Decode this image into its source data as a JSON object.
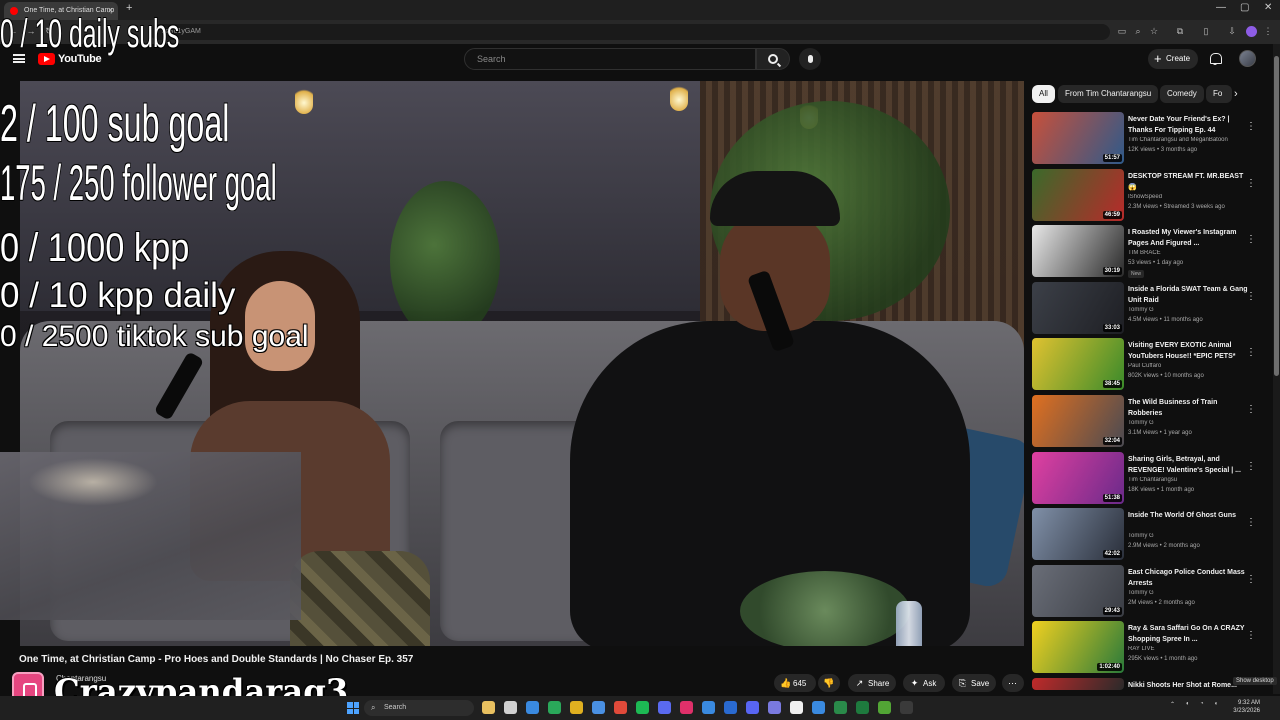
{
  "browser": {
    "tab_title": "One Time, at Christian Camp",
    "url_fragment": "YsGo1yGAM"
  },
  "header": {
    "logo_text": "YouTube",
    "search_placeholder": "Search",
    "create_label": "Create"
  },
  "overlay": {
    "daily_subs": "0 / 10 daily subs",
    "sub_goal": "2  / 100 sub goal",
    "follower_goal": "175 / 250 follower goal",
    "kpp": "0 / 1000 kpp",
    "kpp_daily": "0 / 10 kpp daily",
    "tiktok_goal": "0 / 2500 tiktok sub goal",
    "streamer_name": "Crazypandarag3"
  },
  "video": {
    "title": "One Time, at Christian Camp - Pro Hoes and Double Standards | No Chaser Ep. 357",
    "channel": "Chantarangsu",
    "like_count": "645",
    "share_label": "Share",
    "ask_label": "Ask",
    "save_label": "Save"
  },
  "chips": [
    {
      "label": "All",
      "active": true
    },
    {
      "label": "From Tim Chantarangsu",
      "active": false
    },
    {
      "label": "Comedy",
      "active": false
    },
    {
      "label": "Fo",
      "active": false
    }
  ],
  "recommendations": [
    {
      "title": "Never Date Your Friend's Ex? | Thanks For Tipping Ep. 44",
      "channel": "Tim Chantarangsu and MeganBatoon",
      "meta": "12K views • 3 months ago",
      "duration": "51:57",
      "badge": "",
      "colors": [
        "#c7503b",
        "#2f5a8a"
      ]
    },
    {
      "title": "DESKTOP STREAM FT. MR.BEAST 😱",
      "channel": "IShowSpeed",
      "meta": "2.3M views • Streamed 3 weeks ago",
      "duration": "46:59",
      "badge": "",
      "colors": [
        "#3a6a2a",
        "#b82a2a"
      ]
    },
    {
      "title": "I Roasted My Viewer's Instagram Pages And Figured ...",
      "channel": "TIM BRACE",
      "meta": "53 views • 1 day ago",
      "duration": "30:19",
      "badge": "New",
      "colors": [
        "#e8e8e8",
        "#2a2a2a"
      ]
    },
    {
      "title": "Inside a Florida SWAT Team & Gang Unit Raid",
      "channel": "Tommy G",
      "meta": "4.5M views • 11 months ago",
      "duration": "33:03",
      "badge": "",
      "colors": [
        "#3c4048",
        "#1e1f24"
      ]
    },
    {
      "title": "Visiting EVERY EXOTIC Animal YouTubers House!! *EPIC PETS*",
      "channel": "Paul Cuffaro",
      "meta": "802K views • 10 months ago",
      "duration": "38:45",
      "badge": "",
      "colors": [
        "#e0c230",
        "#3a8a2a"
      ]
    },
    {
      "title": "The Wild Business of Train Robberies",
      "channel": "Tommy G",
      "meta": "3.1M views • 1 year ago",
      "duration": "32:04",
      "badge": "",
      "colors": [
        "#e07020",
        "#4a4a52"
      ]
    },
    {
      "title": "Sharing Girls, Betrayal, and REVENGE! Valentine's Special | ...",
      "channel": "Tim Chantarangsu",
      "meta": "18K views • 1 month ago",
      "duration": "51:38",
      "badge": "",
      "colors": [
        "#e040a0",
        "#6a2a8a"
      ]
    },
    {
      "title": "Inside The World Of Ghost Guns",
      "channel": "Tommy G",
      "meta": "2.9M views • 2 months ago",
      "duration": "42:02",
      "badge": "",
      "colors": [
        "#8090a8",
        "#2a2f3a"
      ]
    },
    {
      "title": "East Chicago Police Conduct Mass Arrests",
      "channel": "Tommy G",
      "meta": "2M views • 2 months ago",
      "duration": "29:43",
      "badge": "",
      "colors": [
        "#6a6e78",
        "#3a3d44"
      ]
    },
    {
      "title": "Ray & Sara Saffari Go On A CRAZY Shopping Spree In ...",
      "channel": "RAY LIVE",
      "meta": "295K views • 1 month ago",
      "duration": "1:02:40",
      "badge": "",
      "colors": [
        "#f0d020",
        "#2a7a3a"
      ]
    },
    {
      "title": "Nikki Shoots Her Shot at Rome...",
      "channel": "",
      "meta": "",
      "duration": "",
      "badge": "",
      "colors": [
        "#c02a2a",
        "#2a2a2a"
      ]
    }
  ],
  "taskbar": {
    "search_label": "Search",
    "time": "9:32 AM",
    "date": "3/23/2026",
    "show_desktop": "Show desktop"
  },
  "colors": {
    "accent": "#ff0000",
    "bg": "#0f0f0f"
  }
}
